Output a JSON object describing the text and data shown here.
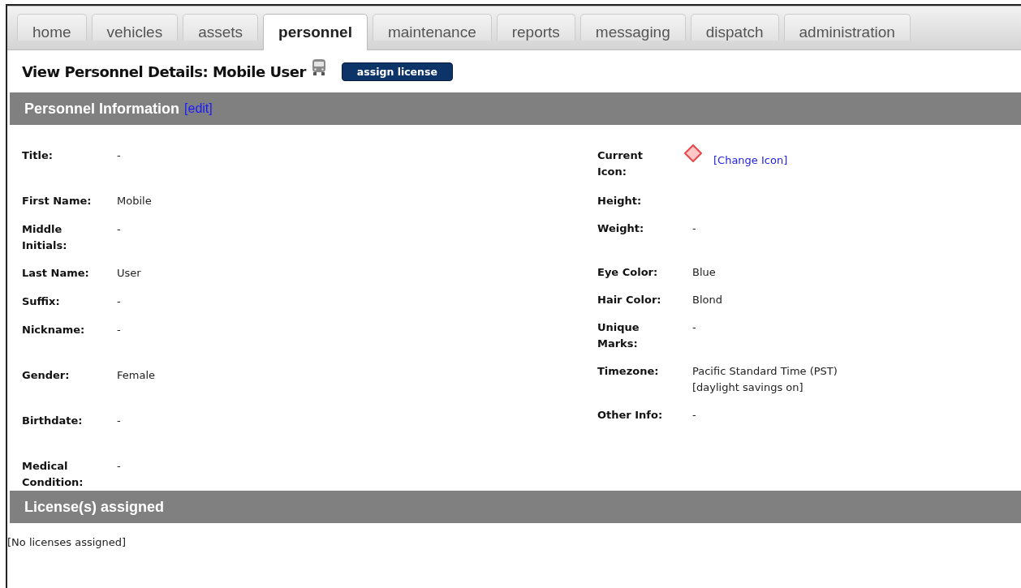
{
  "tabs": [
    {
      "label": "home",
      "selected": false
    },
    {
      "label": "vehicles",
      "selected": false
    },
    {
      "label": "assets",
      "selected": false
    },
    {
      "label": "personnel",
      "selected": true
    },
    {
      "label": "maintenance",
      "selected": false
    },
    {
      "label": "reports",
      "selected": false
    },
    {
      "label": "messaging",
      "selected": false
    },
    {
      "label": "dispatch",
      "selected": false
    },
    {
      "label": "administration",
      "selected": false
    }
  ],
  "page_title": "View Personnel Details: Mobile User",
  "assign_button": "assign license",
  "personnel_section": {
    "title": "Personnel Information",
    "edit_link": "[edit]"
  },
  "left_fields": [
    {
      "label": "Title:",
      "value": "-"
    },
    {
      "label": "First Name:",
      "value": "Mobile"
    },
    {
      "label": "Middle Initials:",
      "value": "-"
    },
    {
      "label": "Last Name:",
      "value": "User"
    },
    {
      "label": "Suffix:",
      "value": "-"
    },
    {
      "label": "Nickname:",
      "value": "-"
    },
    {
      "label": "Gender:",
      "value": "Female"
    },
    {
      "label": "Birthdate:",
      "value": "-"
    },
    {
      "label": "Medical Condition:",
      "value": "-"
    }
  ],
  "right_fields": [
    {
      "label": "Current Icon:",
      "kind": "icon",
      "link": "[Change Icon]"
    },
    {
      "label": "Height:",
      "kind": "text"
    },
    {
      "label": "Weight:",
      "kind": "text",
      "value": "-"
    },
    {
      "label": "Eye Color:",
      "kind": "text",
      "value": "Blue"
    },
    {
      "label": "Hair Color:",
      "kind": "text",
      "value": "Blond"
    },
    {
      "label": "Unique Marks:",
      "kind": "text",
      "value": "-"
    },
    {
      "label": "Timezone:",
      "kind": "text",
      "value": "Pacific Standard Time (PST) [daylight savings on]"
    },
    {
      "label": "Other Info:",
      "kind": "text",
      "value": "-"
    }
  ],
  "license_section": {
    "title": "License(s) assigned",
    "empty_text": "[No licenses assigned]"
  }
}
